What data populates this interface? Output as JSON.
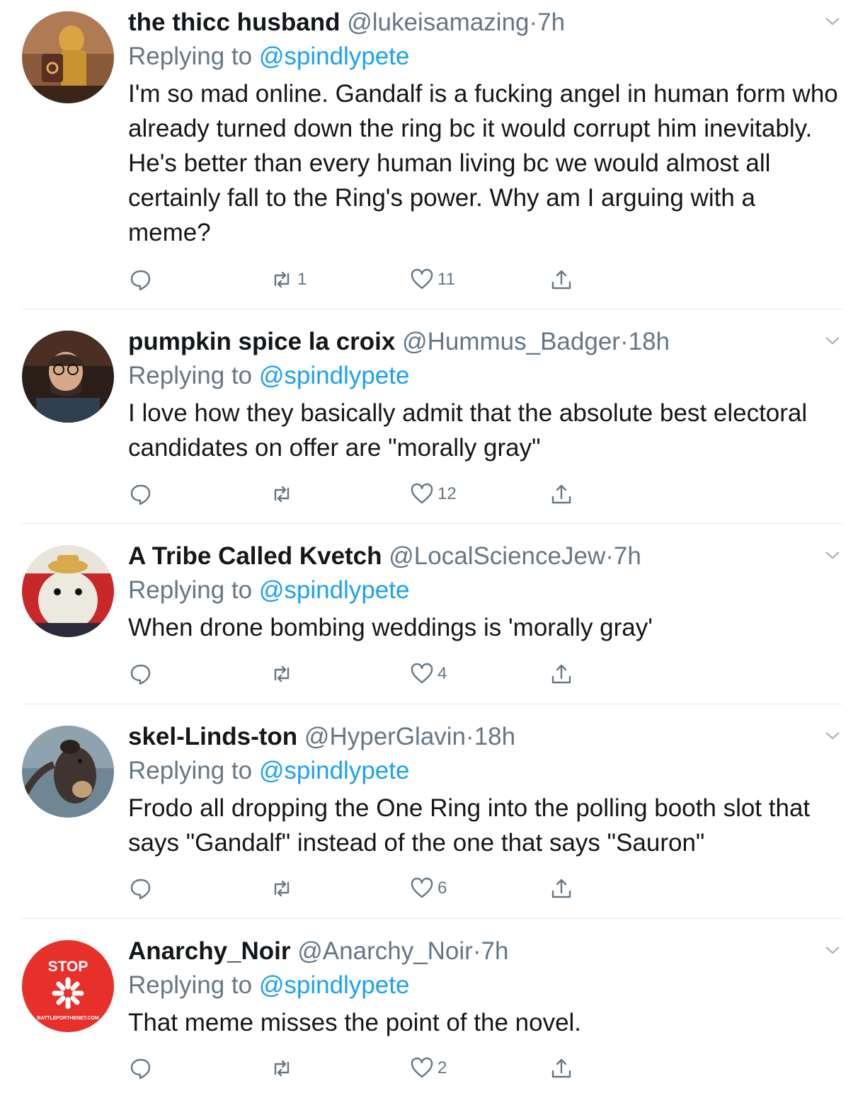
{
  "colors": {
    "link": "#1da1f2",
    "muted": "#657786",
    "text": "#14171a",
    "divider": "#e1e8ed"
  },
  "replying_label": "Replying to",
  "dot": "·",
  "tweets": [
    {
      "name": "the thicc husband",
      "handle": "@lukeisamazing",
      "time": "7h",
      "reply_to": "@spindlypete",
      "text": "I'm so mad online. Gandalf is a fucking angel in human form who already turned down the ring bc it would corrupt him inevitably. He's better than every human living bc we would almost all certainly fall to the Ring's power. Why am I arguing with a meme?",
      "retweets": "1",
      "likes": "11"
    },
    {
      "name": "pumpkin spice la croix",
      "handle": "@Hummus_Badger",
      "time": "18h",
      "reply_to": "@spindlypete",
      "text": "I love how they basically admit that the absolute best electoral candidates on offer are \"morally gray\"",
      "retweets": "",
      "likes": "12"
    },
    {
      "name": "A Tribe Called Kvetch",
      "handle": "@LocalScienceJew",
      "time": "7h",
      "reply_to": "@spindlypete",
      "text": "When drone bombing weddings is 'morally gray'",
      "retweets": "",
      "likes": "4"
    },
    {
      "name": "skel-Linds-ton",
      "handle": "@HyperGlavin",
      "time": "18h",
      "reply_to": "@spindlypete",
      "text": "Frodo all dropping the One Ring into the polling booth slot that says \"Gandalf\" instead of the one that says \"Sauron\"",
      "retweets": "",
      "likes": "6"
    },
    {
      "name": "Anarchy_Noir",
      "handle": "@Anarchy_Noir",
      "time": "7h",
      "reply_to": "@spindlypete",
      "text": "That meme misses the point of the novel.",
      "retweets": "",
      "likes": "2",
      "avatar_text": {
        "top": "STOP",
        "bottom": "BATTLEFORTHENET.COM"
      }
    }
  ]
}
